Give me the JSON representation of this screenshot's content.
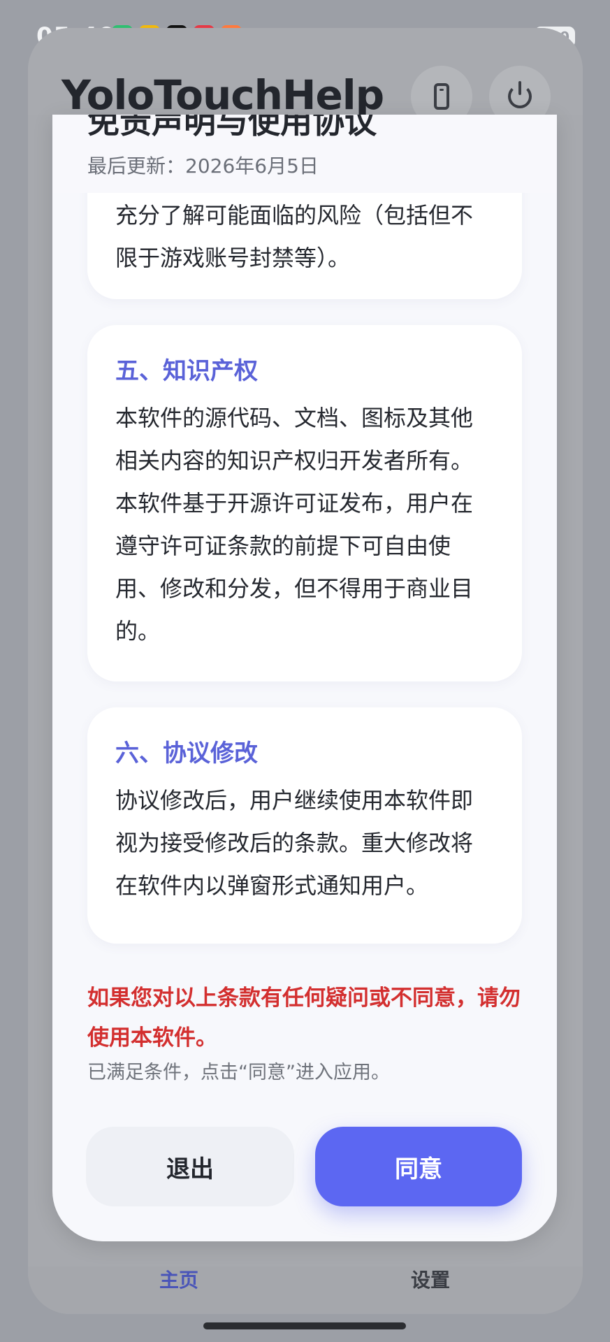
{
  "status": {
    "time": "05:40",
    "battery": "100",
    "apps": [
      {
        "name": "green-app-icon",
        "color": "#2fbf71",
        "glyph": "▮"
      },
      {
        "name": "duck-app-icon",
        "color": "#f2b90c",
        "glyph": "✦"
      },
      {
        "name": "tiktok-app-icon",
        "color": "#111111",
        "glyph": "♪"
      },
      {
        "name": "xiaohongshu-app-icon",
        "color": "#e63946",
        "glyph": "小红书"
      },
      {
        "name": "gallery-app-icon",
        "color": "#ff7a3d",
        "glyph": "▲"
      }
    ]
  },
  "app": {
    "title": "YoloTouchHelp"
  },
  "dialog": {
    "title": "免责声明与使用协议",
    "updated": "最后更新：2026年6月5日",
    "card_partial_text": "充分了解可能面临的风险（包括但不限于游戏账号封禁等）。",
    "section5": {
      "heading": "五、知识产权",
      "body": "本软件的源代码、文档、图标及其他相关内容的知识产权归开发者所有。本软件基于开源许可证发布，用户在遵守许可证条款的前提下可自由使用、修改和分发，但不得用于商业目的。"
    },
    "section6": {
      "heading": "六、协议修改",
      "body": "协议修改后，用户继续使用本软件即视为接受修改后的条款。重大修改将在软件内以弹窗形式通知用户。"
    },
    "warning": "如果您对以上条款有任何疑问或不同意，请勿使用本软件。",
    "note": "已满足条件，点击“同意”进入应用。",
    "exit_label": "退出",
    "agree_label": "同意"
  },
  "nav": {
    "home_label": "主页",
    "settings_label": "设置",
    "active_color": "#4a55b8"
  }
}
